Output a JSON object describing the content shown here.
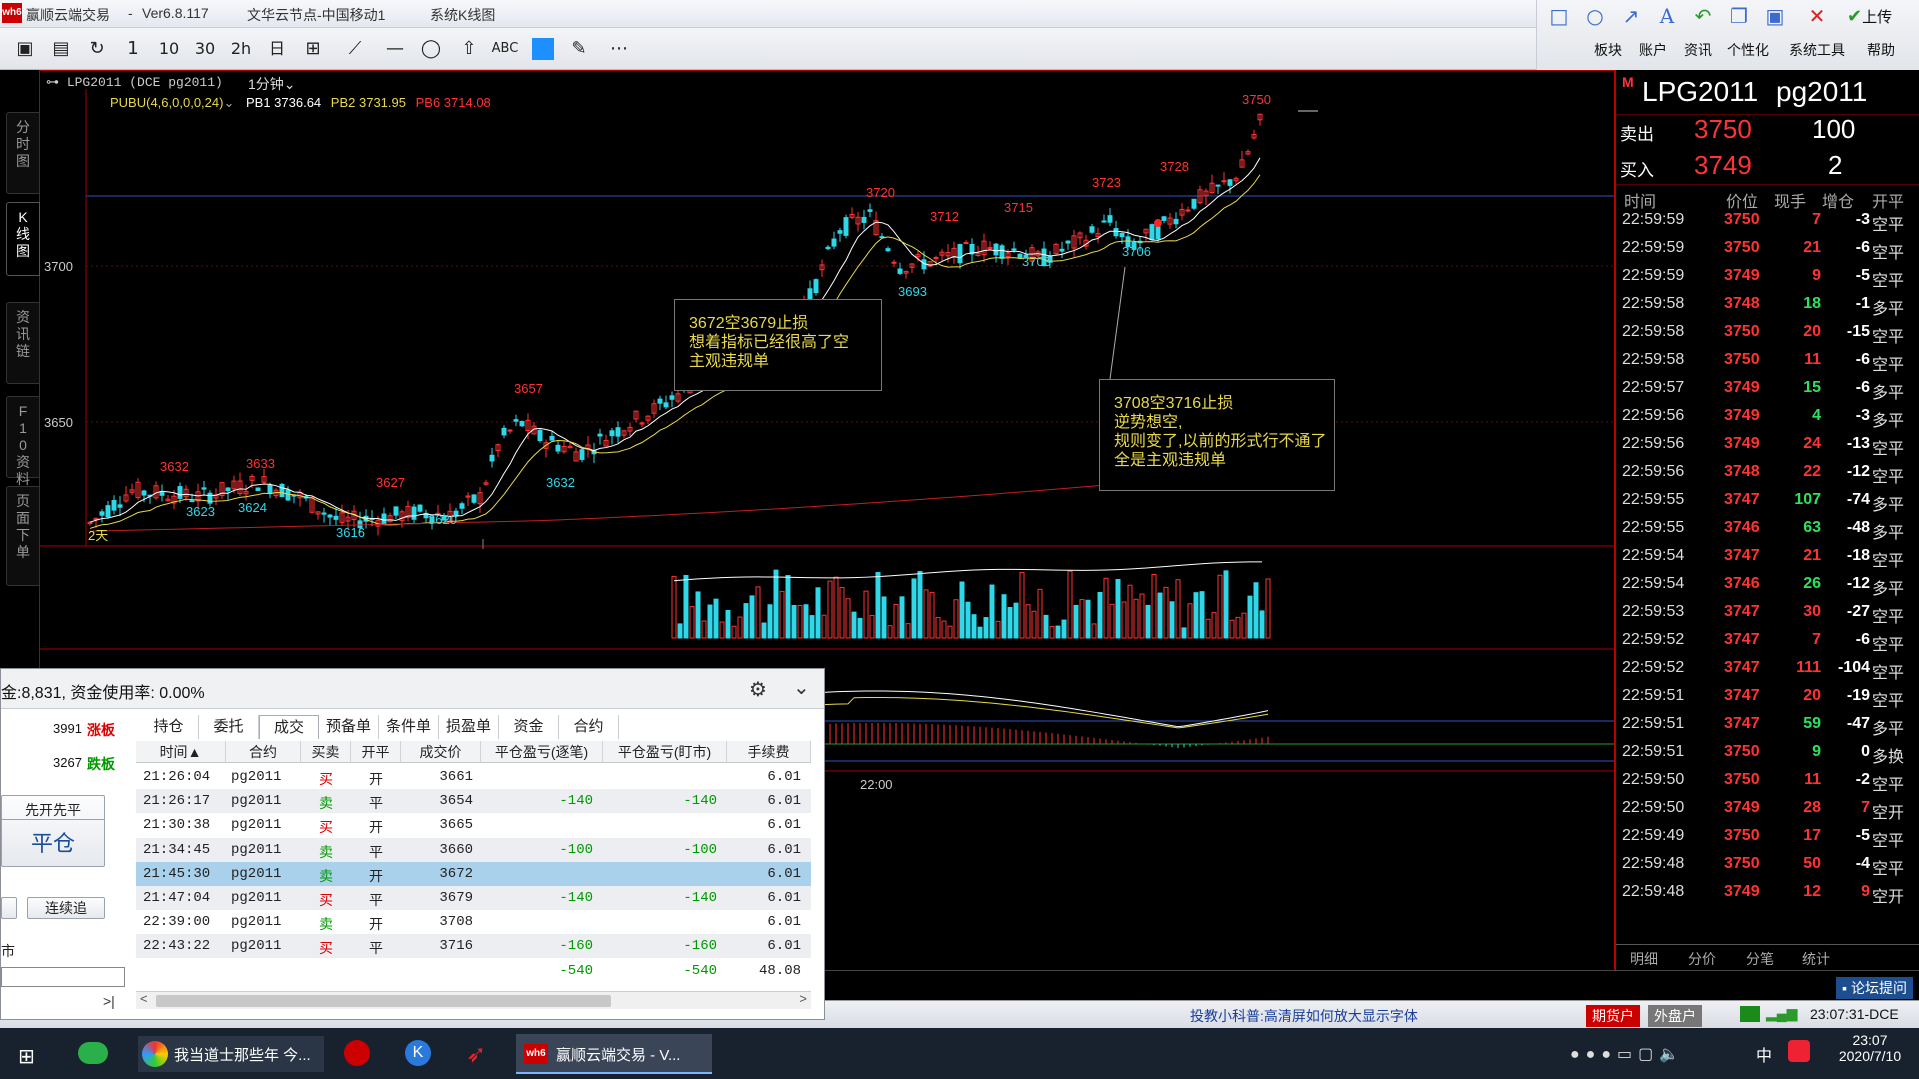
{
  "window": {
    "app_name": "赢顺云端交易",
    "version": "Ver6.8.117",
    "server": "文华云节点-中国移动1",
    "view": "系统K线图",
    "logo_text": "wh6"
  },
  "menu": [
    "板块",
    "账户",
    "资讯",
    "个性化",
    "系统工具",
    "帮助"
  ],
  "upload_label": "上传",
  "toolbar_labels": {
    "one_min": "1",
    "ten": "10",
    "thirty": "30",
    "two_h": "2h",
    "day": "日",
    "abc": "ABC"
  },
  "left_tabs": [
    "分时图",
    "K线图",
    "资讯链",
    "F10资料",
    "页面下单"
  ],
  "chart": {
    "symbol_header": "LPG2011 (DCE pg2011)",
    "period": "1分钟",
    "indicator_name": "PUBU(4,6,0,0,0,24)",
    "pb1": "PB1 3736.64",
    "pb2": "PB2 3731.95",
    "pb6": "PB6 3714.08",
    "y_labels": [
      "3700",
      "3650"
    ],
    "time_label": "22:00",
    "day_label": "2天",
    "peak_labels": [
      {
        "text": "3632",
        "color": "red"
      },
      {
        "text": "3633",
        "color": "red"
      },
      {
        "text": "3627",
        "color": "red"
      },
      {
        "text": "3657",
        "color": "red"
      },
      {
        "text": "3720",
        "color": "red"
      },
      {
        "text": "3712",
        "color": "red"
      },
      {
        "text": "3715",
        "color": "red"
      },
      {
        "text": "3723",
        "color": "red"
      },
      {
        "text": "3728",
        "color": "red"
      },
      {
        "text": "3750",
        "color": "red"
      }
    ],
    "trough_labels": [
      "3623",
      "3624",
      "3616",
      "3620",
      "3632",
      "3693",
      "3703",
      "3706"
    ],
    "note1": [
      "3672空3679止损",
      "想着指标已经很高了空",
      "主观违规单"
    ],
    "note2": [
      "3708空3716止损",
      "逆势想空,",
      "规则变了,以前的形式行不通了",
      "全是主观违规单"
    ]
  },
  "quote": {
    "badge": "M",
    "name": "LPG2011",
    "code": "pg2011",
    "sell_label": "卖出",
    "sell_price": "3750",
    "sell_vol": "100",
    "buy_label": "买入",
    "buy_price": "3749",
    "buy_vol": "2",
    "headers": [
      "时间",
      "价位",
      "现手",
      "增仓",
      "开平"
    ],
    "trades": [
      [
        "22:59:59",
        "3750",
        "7",
        "-3",
        "空平"
      ],
      [
        "22:59:59",
        "3750",
        "21",
        "-6",
        "空平"
      ],
      [
        "22:59:59",
        "3749",
        "9",
        "-5",
        "空平"
      ],
      [
        "22:59:58",
        "3748",
        "18",
        "-1",
        "多平"
      ],
      [
        "22:59:58",
        "3750",
        "20",
        "-15",
        "空平"
      ],
      [
        "22:59:58",
        "3750",
        "11",
        "-6",
        "空平"
      ],
      [
        "22:59:57",
        "3749",
        "15",
        "-6",
        "多平"
      ],
      [
        "22:59:56",
        "3749",
        "4",
        "-3",
        "多平"
      ],
      [
        "22:59:56",
        "3749",
        "24",
        "-13",
        "空平"
      ],
      [
        "22:59:56",
        "3748",
        "22",
        "-12",
        "空平"
      ],
      [
        "22:59:55",
        "3747",
        "107",
        "-74",
        "多平"
      ],
      [
        "22:59:55",
        "3746",
        "63",
        "-48",
        "多平"
      ],
      [
        "22:59:54",
        "3747",
        "21",
        "-18",
        "空平"
      ],
      [
        "22:59:54",
        "3746",
        "26",
        "-12",
        "多平"
      ],
      [
        "22:59:53",
        "3747",
        "30",
        "-27",
        "空平"
      ],
      [
        "22:59:52",
        "3747",
        "7",
        "-6",
        "空平"
      ],
      [
        "22:59:52",
        "3747",
        "111",
        "-104",
        "空平"
      ],
      [
        "22:59:51",
        "3747",
        "20",
        "-19",
        "空平"
      ],
      [
        "22:59:51",
        "3747",
        "59",
        "-47",
        "多平"
      ],
      [
        "22:59:51",
        "3750",
        "9",
        "0",
        "多换"
      ],
      [
        "22:59:50",
        "3750",
        "11",
        "-2",
        "空平"
      ],
      [
        "22:59:50",
        "3749",
        "28",
        "7",
        "空开"
      ],
      [
        "22:59:49",
        "3750",
        "17",
        "-5",
        "空平"
      ],
      [
        "22:59:48",
        "3750",
        "50",
        "-4",
        "空平"
      ],
      [
        "22:59:48",
        "3749",
        "12",
        "9",
        "空开"
      ]
    ],
    "bottom_tabs": [
      "明细",
      "分价",
      "分笔",
      "统计"
    ]
  },
  "trade_panel": {
    "summary": "金:8,831, 资金使用率: 0.00%",
    "limit_up_price": "3991",
    "limit_up_label": "涨板",
    "limit_down_price": "3267",
    "limit_down_label": "跌板",
    "open_close_mode": "先开先平",
    "close_button": "平仓",
    "continue_button": "连续追",
    "market_label": "市",
    "tabs": [
      "持仓",
      "委托",
      "成交",
      "预备单",
      "条件单",
      "损盈单",
      "资金",
      "合约"
    ],
    "columns": [
      "时间",
      "合约",
      "买卖",
      "开平",
      "成交价",
      "平仓盈亏(逐笔)",
      "平仓盈亏(盯市)",
      "手续费"
    ],
    "sort_arrow": "▲",
    "rows": [
      [
        "21:26:04",
        "pg2011",
        "买",
        "开",
        "3661",
        "",
        "",
        "6.01"
      ],
      [
        "21:26:17",
        "pg2011",
        "卖",
        "平",
        "3654",
        "-140",
        "-140",
        "6.01"
      ],
      [
        "21:30:38",
        "pg2011",
        "买",
        "开",
        "3665",
        "",
        "",
        "6.01"
      ],
      [
        "21:34:45",
        "pg2011",
        "卖",
        "平",
        "3660",
        "-100",
        "-100",
        "6.01"
      ],
      [
        "21:45:30",
        "pg2011",
        "卖",
        "开",
        "3672",
        "",
        "",
        "6.01"
      ],
      [
        "21:47:04",
        "pg2011",
        "买",
        "平",
        "3679",
        "-140",
        "-140",
        "6.01"
      ],
      [
        "22:39:00",
        "pg2011",
        "卖",
        "开",
        "3708",
        "",
        "",
        "6.01"
      ],
      [
        "22:43:22",
        "pg2011",
        "买",
        "平",
        "3716",
        "-160",
        "-160",
        "6.01"
      ]
    ],
    "totals": [
      "",
      "",
      "",
      "",
      "",
      "-540",
      "-540",
      "48.08"
    ]
  },
  "status": {
    "forum": "论坛提问",
    "tip": "投教小科普:高清屏如何放大显示字体",
    "futures_account": "期货户",
    "foreign_account": "外盘户",
    "clock": "23:07:31-DCE"
  },
  "taskbar": {
    "item1": "我当道士那些年 今...",
    "item2": "赢顺云端交易 - V...",
    "time": "23:07",
    "date": "2020/7/10",
    "ime": "中"
  }
}
